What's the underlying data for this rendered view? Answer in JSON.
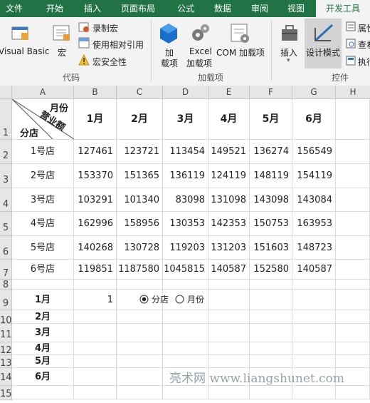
{
  "tabs": [
    "文件",
    "开始",
    "插入",
    "页面布局",
    "公式",
    "数据",
    "审阅",
    "视图",
    "开发工具"
  ],
  "ribbon": {
    "code": {
      "vb": "Visual Basic",
      "macro": "宏",
      "record": "录制宏",
      "relative": "使用相对引用",
      "security": "宏安全性",
      "group": "代码"
    },
    "addins": {
      "addin1": "加",
      "addin2": "载项",
      "excel1": "Excel",
      "excel2": "加载项",
      "com": "COM 加载项",
      "group": "加载项"
    },
    "controls": {
      "insert": "插入",
      "design": "设计模式",
      "prop": "属性",
      "view": "查看",
      "run": "执行",
      "group": "控件"
    }
  },
  "columns": [
    "A",
    "B",
    "C",
    "D",
    "E",
    "F",
    "G",
    "H"
  ],
  "rows": [
    "1",
    "2",
    "3",
    "4",
    "5",
    "6",
    "7",
    "8",
    "9",
    "10",
    "11",
    "12",
    "13",
    "14",
    "15"
  ],
  "header": {
    "month": "月份",
    "sales": "营业额",
    "store": "分店",
    "months": [
      "1月",
      "2月",
      "3月",
      "4月",
      "5月",
      "6月"
    ]
  },
  "table": [
    {
      "store": "1号店",
      "v": [
        "127461",
        "123721",
        "113454",
        "149521",
        "136274",
        "156549"
      ]
    },
    {
      "store": "2号店",
      "v": [
        "153370",
        "151365",
        "136119",
        "124119",
        "148119",
        "154119"
      ]
    },
    {
      "store": "3号店",
      "v": [
        "103291",
        "101340",
        "83098",
        "131098",
        "143098",
        "143084"
      ]
    },
    {
      "store": "4号店",
      "v": [
        "162996",
        "158956",
        "130353",
        "142353",
        "150753",
        "163953"
      ]
    },
    {
      "store": "5号店",
      "v": [
        "140268",
        "130728",
        "119203",
        "131203",
        "151603",
        "148723"
      ]
    },
    {
      "store": "6号店",
      "v": [
        "119851",
        "1187580",
        "1045815",
        "140587",
        "152580",
        "140587"
      ]
    }
  ],
  "list": [
    "1月",
    "2月",
    "3月",
    "4月",
    "5月",
    "6月"
  ],
  "b9": "1",
  "radio": [
    {
      "label": "分店",
      "checked": true
    },
    {
      "label": "月份",
      "checked": false
    }
  ],
  "watermark": "亮术网 www.liangshunet.com"
}
